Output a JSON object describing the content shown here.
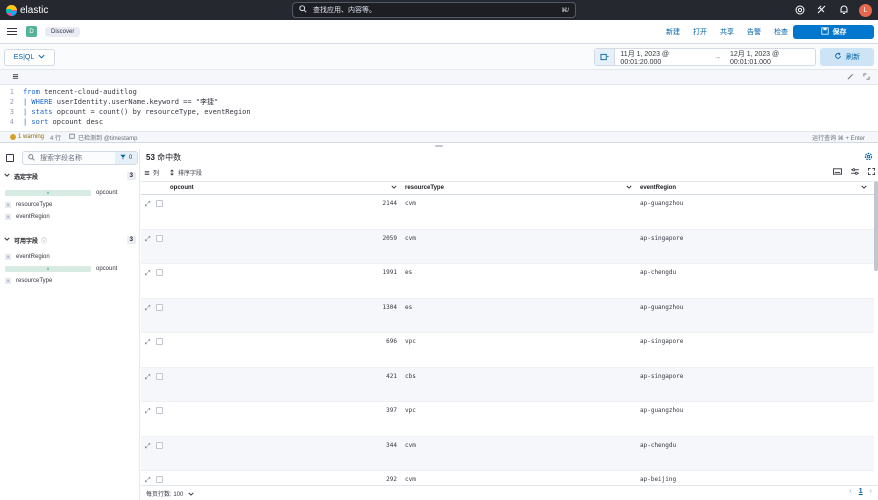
{
  "topbar": {
    "brand": "elastic",
    "search_placeholder": "查找应用、内容等。",
    "search_shortcut": "⌘/",
    "avatar_initial": "L"
  },
  "navbar": {
    "app_badge": "D",
    "breadcrumb": "Discover",
    "links": [
      "新建",
      "打开",
      "共享",
      "告警",
      "检查"
    ],
    "save_label": "保存"
  },
  "query": {
    "language_label": "ES|QL",
    "date_start": "11月 1, 2023 @ 00:01:20.000",
    "date_arrow": "→",
    "date_end": "12月 1, 2023 @ 00:01:01.000",
    "refresh_label": "刷新"
  },
  "editor": {
    "lines": [
      {
        "n": "1",
        "kw": "from",
        "rest": " tencent-cloud-auditlog"
      },
      {
        "n": "2",
        "kw": "| WHERE",
        "rest": " userIdentity.userName.keyword == \"李捷\""
      },
      {
        "n": "3",
        "kw": "| stats",
        "rest": " opcount = count() by resourceType, eventRegion"
      },
      {
        "n": "4",
        "kw": "| sort",
        "rest": " opcount desc"
      }
    ],
    "warning": "1 warning",
    "lines_count": "4 行",
    "timestamp_note": "已检测到 @timestamp",
    "run_hint": "运行查询  ⌘ + Enter"
  },
  "sidebar": {
    "search_placeholder": "搜索字段名称",
    "filter_count": "0",
    "selected_label": "选定字段",
    "selected_count": "3",
    "selected_fields": [
      "opcount",
      "resourceType",
      "eventRegion"
    ],
    "available_label": "可用字段",
    "available_count": "3",
    "available_fields": [
      "eventRegion",
      "opcount",
      "resourceType"
    ]
  },
  "grid": {
    "hits_count": "53",
    "hits_label": "命中数",
    "columns_label": "列",
    "sort_label": "排序字段",
    "headers": [
      "opcount",
      "resourceType",
      "eventRegion"
    ],
    "rows": [
      {
        "opcount": "2144",
        "resourceType": "cvm",
        "eventRegion": "ap-guangzhou"
      },
      {
        "opcount": "2059",
        "resourceType": "cvm",
        "eventRegion": "ap-singapore"
      },
      {
        "opcount": "1991",
        "resourceType": "es",
        "eventRegion": "ap-chengdu"
      },
      {
        "opcount": "1304",
        "resourceType": "es",
        "eventRegion": "ap-guangzhou"
      },
      {
        "opcount": "696",
        "resourceType": "vpc",
        "eventRegion": "ap-singapore"
      },
      {
        "opcount": "421",
        "resourceType": "cbs",
        "eventRegion": "ap-singapore"
      },
      {
        "opcount": "397",
        "resourceType": "vpc",
        "eventRegion": "ap-guangzhou"
      },
      {
        "opcount": "344",
        "resourceType": "cvm",
        "eventRegion": "ap-chengdu"
      },
      {
        "opcount": "292",
        "resourceType": "cvm",
        "eventRegion": "ap-beijing"
      }
    ],
    "rows_per_page": "每页行数: 100",
    "current_page": "1"
  }
}
